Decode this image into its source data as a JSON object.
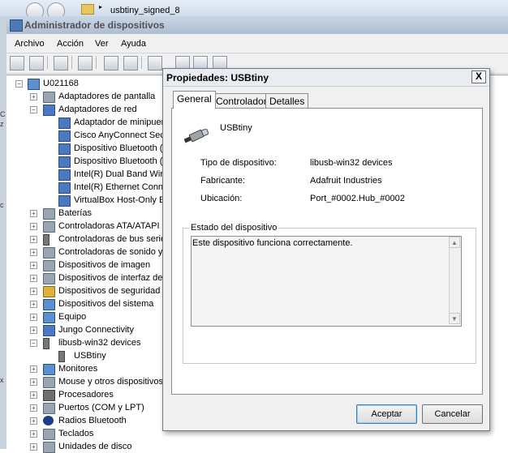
{
  "explorer": {
    "breadcrumb": "usbtiny_signed_8"
  },
  "window": {
    "title": "Administrador de dispositivos",
    "menu": [
      "Archivo",
      "Acción",
      "Ver",
      "Ayuda"
    ]
  },
  "tree": {
    "root": "U021168",
    "items": [
      {
        "label": "Adaptadores de pantalla",
        "expanded": false
      },
      {
        "label": "Adaptadores de red",
        "expanded": true
      },
      {
        "label": "Adaptador de minipuer",
        "child": true
      },
      {
        "label": "Cisco AnyConnect Secu",
        "child": true
      },
      {
        "label": "Dispositivo Bluetooth (",
        "child": true
      },
      {
        "label": "Dispositivo Bluetooth (",
        "child": true
      },
      {
        "label": "Intel(R) Dual Band Wire",
        "child": true
      },
      {
        "label": "Intel(R) Ethernet Conn",
        "child": true
      },
      {
        "label": "VirtualBox Host-Only E",
        "child": true
      },
      {
        "label": "Baterías",
        "expanded": false
      },
      {
        "label": "Controladoras ATA/ATAPI",
        "expanded": false
      },
      {
        "label": "Controladoras de bus serie",
        "expanded": false
      },
      {
        "label": "Controladoras de sonido y",
        "expanded": false
      },
      {
        "label": "Dispositivos de imagen",
        "expanded": false
      },
      {
        "label": "Dispositivos de interfaz de",
        "expanded": false
      },
      {
        "label": "Dispositivos de seguridad",
        "expanded": false
      },
      {
        "label": "Dispositivos del sistema",
        "expanded": false
      },
      {
        "label": "Equipo",
        "expanded": false
      },
      {
        "label": "Jungo Connectivity",
        "expanded": false
      },
      {
        "label": "libusb-win32 devices",
        "expanded": true
      },
      {
        "label": "USBtiny",
        "child": true
      },
      {
        "label": "Monitores",
        "expanded": false
      },
      {
        "label": "Mouse y otros dispositivos",
        "expanded": false
      },
      {
        "label": "Procesadores",
        "expanded": false
      },
      {
        "label": "Puertos (COM y LPT)",
        "expanded": false
      },
      {
        "label": "Radios Bluetooth",
        "expanded": false
      },
      {
        "label": "Teclados",
        "expanded": false
      },
      {
        "label": "Unidades de disco",
        "expanded": false
      }
    ]
  },
  "dialog": {
    "title": "Propiedades: USBtiny",
    "close_symbol": "X",
    "tabs": [
      "General",
      "Controlador",
      "Detalles"
    ],
    "active_tab": "General",
    "device_name": "USBtiny",
    "properties": [
      {
        "label": "Tipo de dispositivo:",
        "value": "libusb-win32 devices"
      },
      {
        "label": "Fabricante:",
        "value": "Adafruit Industries"
      },
      {
        "label": "Ubicación:",
        "value": "Port_#0002.Hub_#0002"
      }
    ],
    "status_legend": "Estado del dispositivo",
    "status_text": "Este dispositivo funciona correctamente.",
    "buttons": {
      "ok": "Aceptar",
      "cancel": "Cancelar"
    }
  },
  "colors": {
    "titlebar": "#aebdd0",
    "dialog_bg": "#f0f0f0",
    "default_button_border": "#3c7fb1"
  }
}
